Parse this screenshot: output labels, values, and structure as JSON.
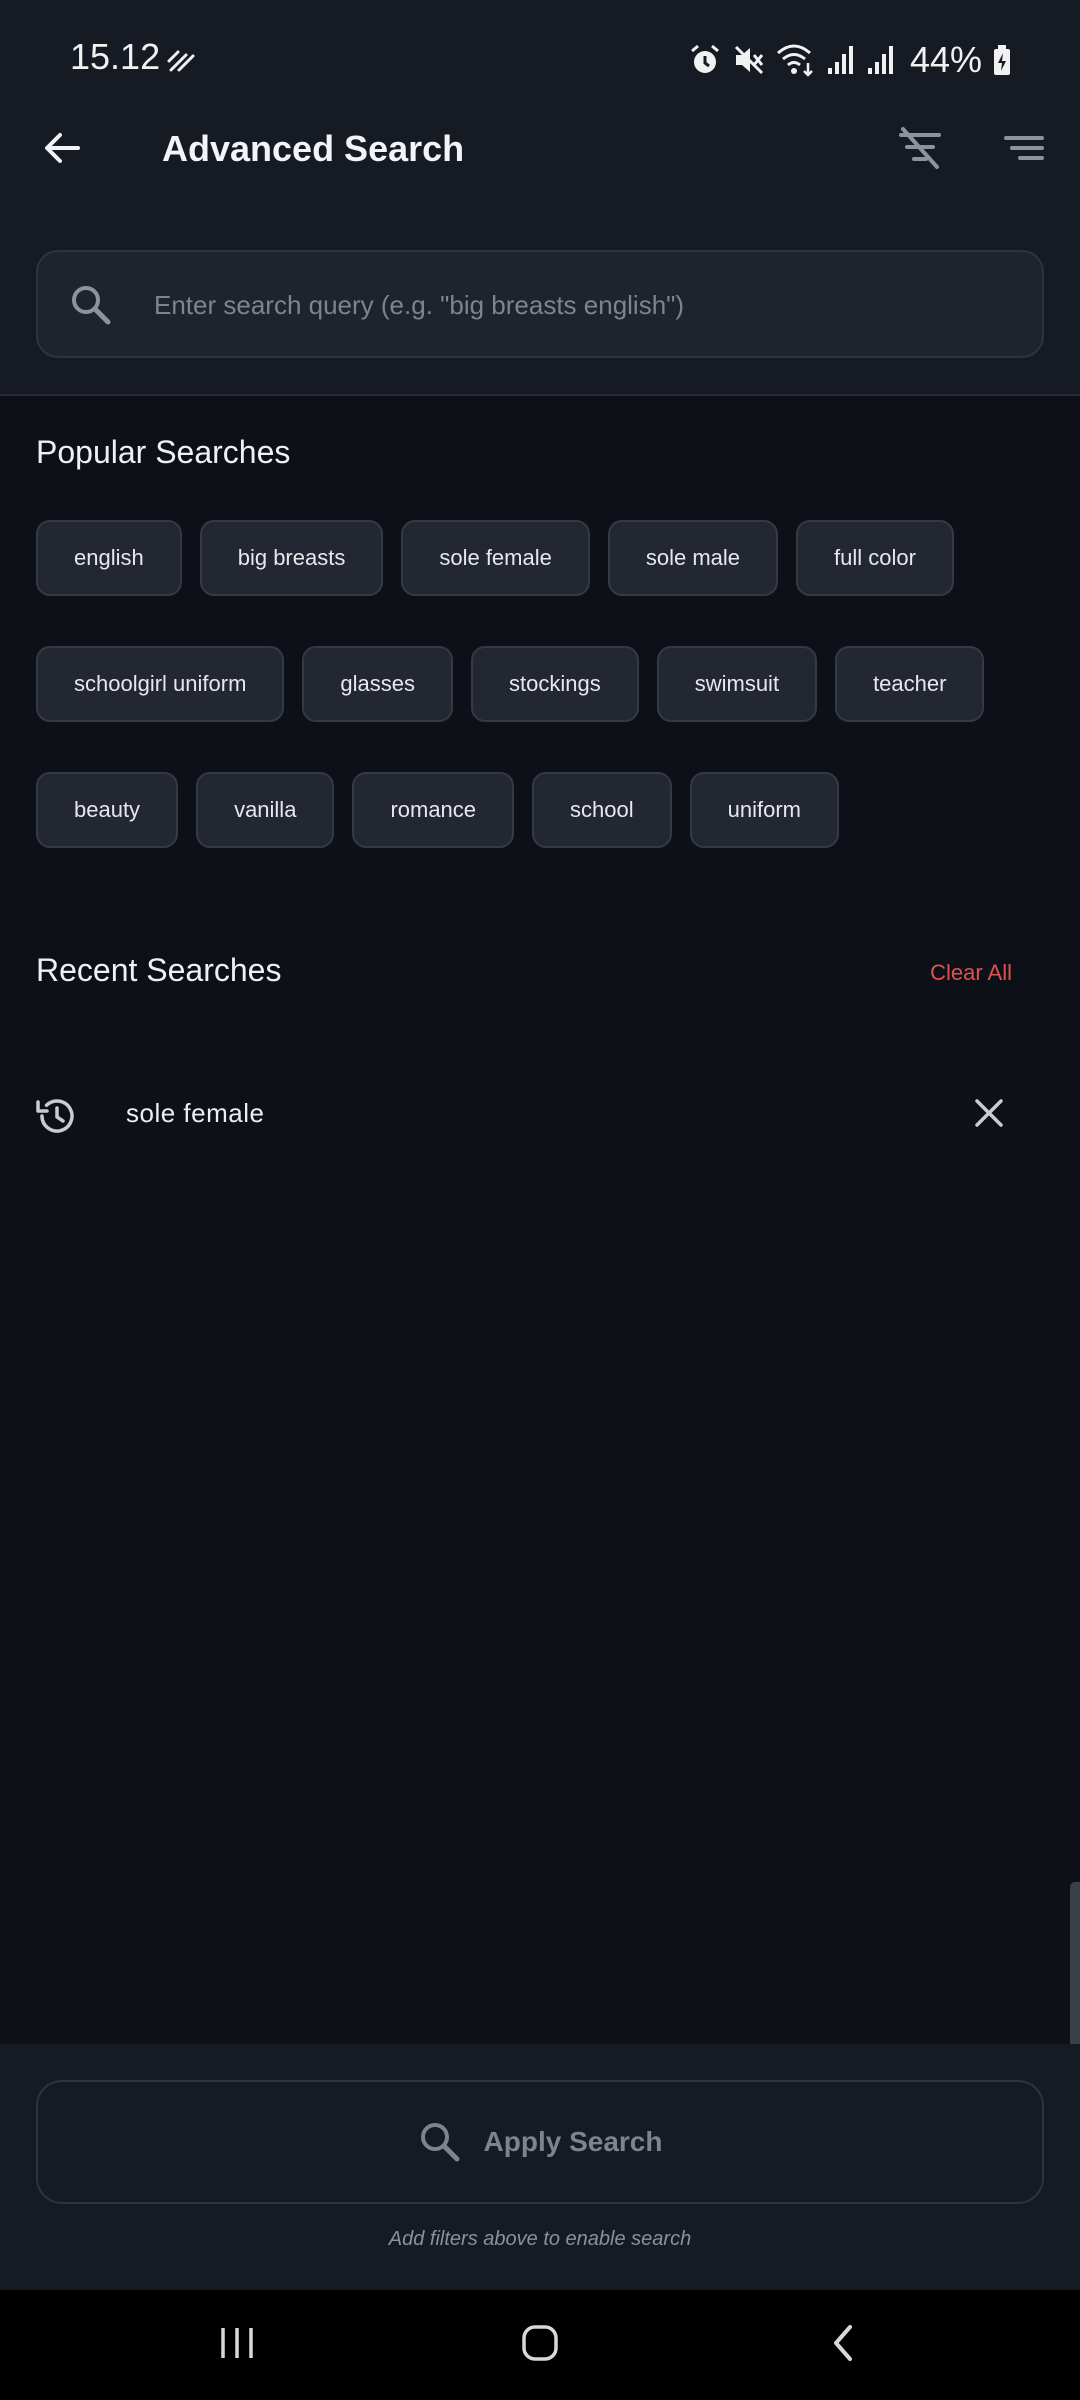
{
  "status_bar": {
    "time": "15.12",
    "battery": "44%",
    "icons": [
      "data-saver-icon",
      "alarm-icon",
      "mute-icon",
      "wifi-icon",
      "signal-icon",
      "signal-icon",
      "battery-charging-icon"
    ]
  },
  "app_bar": {
    "title": "Advanced Search",
    "back_icon": "arrow-back-icon",
    "actions": [
      "filter-off-icon",
      "sort-icon"
    ]
  },
  "search": {
    "value": "",
    "placeholder": "Enter search query (e.g. \"big breasts english\")"
  },
  "popular": {
    "title": "Popular Searches",
    "rows": [
      [
        "english",
        "big breasts",
        "sole female",
        "sole male",
        "full color"
      ],
      [
        "schoolgirl uniform",
        "glasses",
        "stockings",
        "swimsuit",
        "teacher"
      ],
      [
        "beauty",
        "vanilla",
        "romance",
        "school",
        "uniform"
      ]
    ]
  },
  "recent": {
    "title": "Recent Searches",
    "clear_all": "Clear All",
    "items": [
      {
        "text": "sole female"
      }
    ]
  },
  "apply": {
    "label": "Apply Search",
    "hint": "Add filters above to enable search"
  },
  "colors": {
    "background": "#0d1017",
    "surface": "#161a22",
    "chip": "#232731",
    "accent_red": "#e0524f",
    "muted_text": "#7d838f"
  }
}
